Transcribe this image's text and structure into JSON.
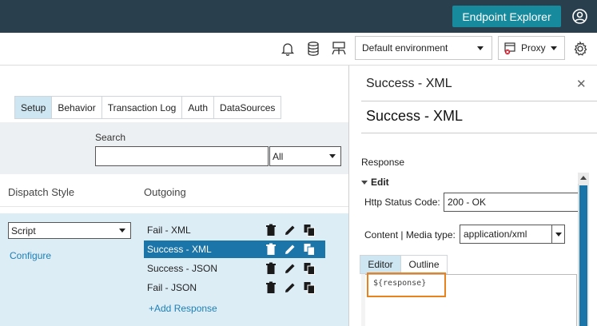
{
  "header": {
    "endpoint_explorer_label": "Endpoint Explorer",
    "user_icon": "user-circle-icon"
  },
  "toolbar": {
    "icons": [
      "bell-icon",
      "database-icon",
      "network-icon",
      "gear-icon"
    ],
    "environment": "Default environment",
    "proxy_label": "Proxy"
  },
  "left": {
    "tabs": [
      "Setup",
      "Behavior",
      "Transaction Log",
      "Auth",
      "DataSources"
    ],
    "active_tab": "Setup",
    "search_label": "Search",
    "search_value": "",
    "filter_value": "All",
    "dispatch_header": "Dispatch Style",
    "outgoing_header": "Outgoing",
    "dispatch_value": "Script",
    "configure_label": "Configure",
    "responses": [
      {
        "label": "Fail - XML",
        "selected": false
      },
      {
        "label": "Success - XML",
        "selected": true
      },
      {
        "label": "Success - JSON",
        "selected": false
      },
      {
        "label": "Fail - JSON",
        "selected": false
      }
    ],
    "add_response_label": "+Add Response",
    "row_icons": [
      "trash-icon",
      "pencil-icon",
      "copy-icon"
    ]
  },
  "right": {
    "panel_title": "Success - XML",
    "heading": "Success - XML",
    "response_label": "Response",
    "edit_label": "Edit",
    "http_status_label": "Http Status Code:",
    "http_status_value": "200 - OK",
    "content_media_label": "Content | Media type:",
    "media_type_value": "application/xml",
    "editor_tabs": [
      "Editor",
      "Outline"
    ],
    "active_editor_tab": "Editor",
    "editor_code": "${response}"
  },
  "colors": {
    "topbar": "#2a3f4d",
    "accent_button": "#178b9d",
    "selected_row": "#1b75a8",
    "highlight": "#e8821e",
    "link": "#1f7fb5"
  }
}
